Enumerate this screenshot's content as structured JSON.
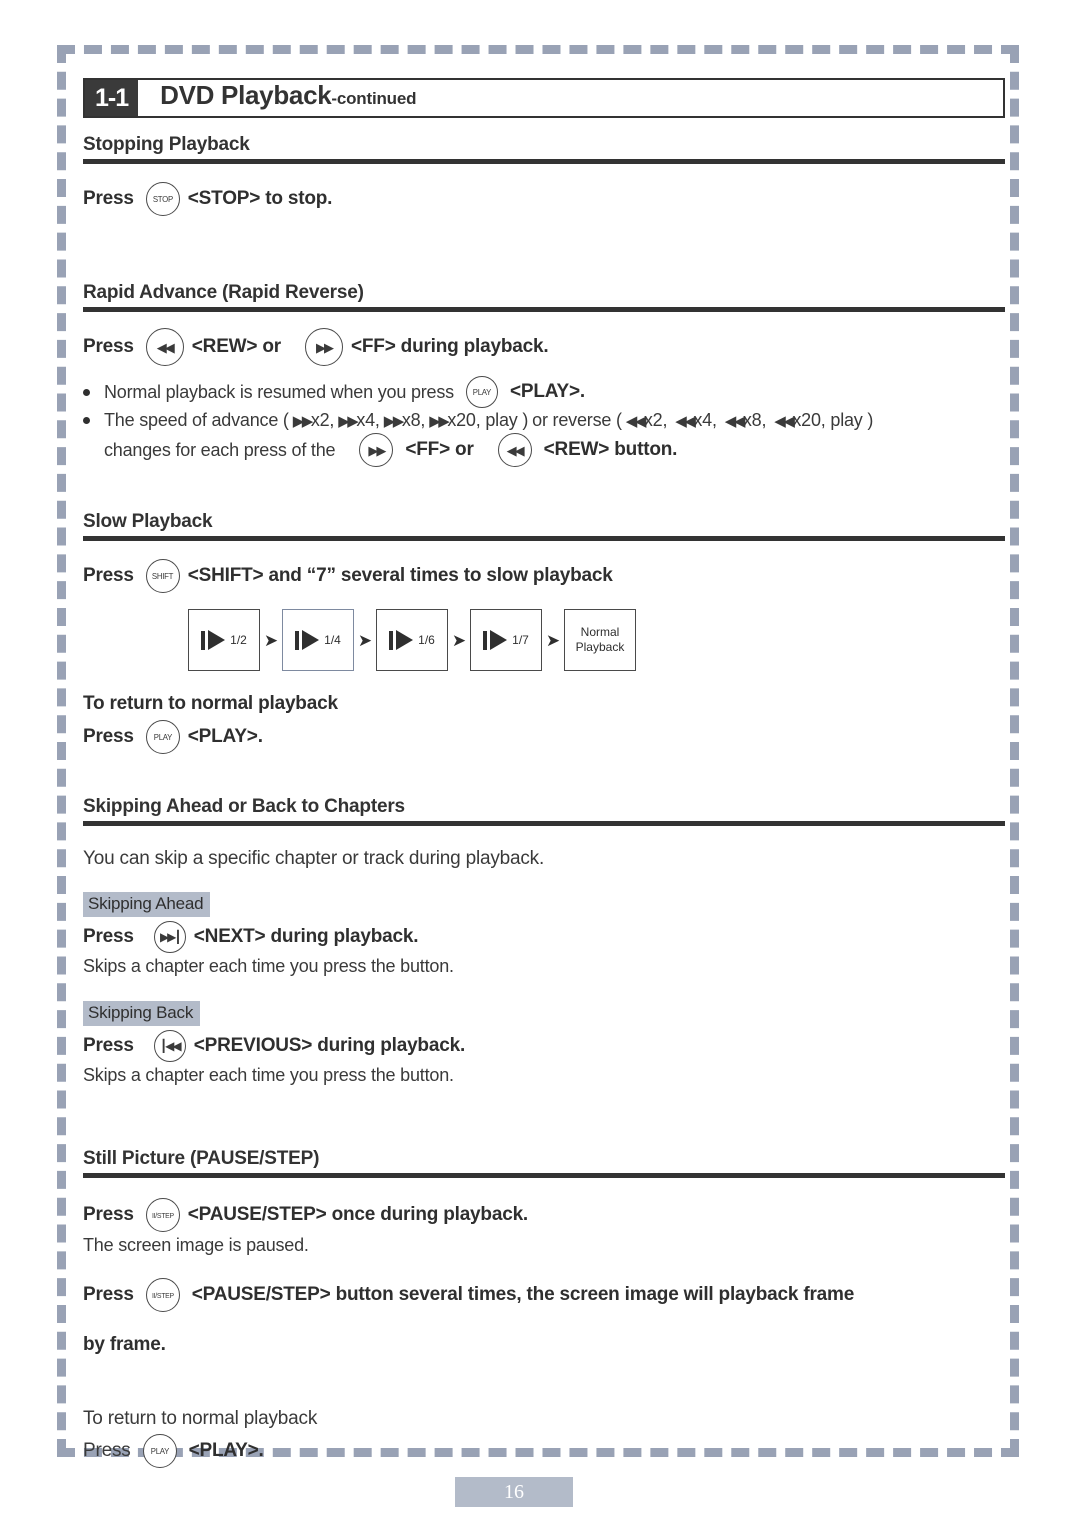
{
  "header": {
    "badge": "1-1",
    "title_main": "DVD Playback",
    "title_suffix": "-continued"
  },
  "sections": {
    "stopping": {
      "heading": "Stopping Playback",
      "press_label": "Press",
      "button": "STOP",
      "text": "<STOP> to stop."
    },
    "rapid": {
      "heading": "Rapid Advance (Rapid Reverse)",
      "press_label": "Press",
      "btn_rew": "rew-glyph",
      "text_rew": "<REW> or",
      "btn_ff": "ff-glyph",
      "text_ff": "<FF> during playback.",
      "bullet1_pre": "Normal playback is resumed when you press",
      "bullet1_btn": "PLAY",
      "bullet1_post": "<PLAY>.",
      "bullet2_a": "The speed of advance (",
      "bullet2_fwd": [
        "x2,",
        "x4,",
        "x8,",
        "x20, play )"
      ],
      "bullet2_b": "or reverse (",
      "bullet2_rev": [
        "x2,",
        "x4,",
        "x8,",
        "x20, play )"
      ],
      "bullet2_c": "changes for each press of the",
      "bullet2_ff": "<FF> or",
      "bullet2_rew": "<REW> button."
    },
    "slow": {
      "heading": "Slow Playback",
      "press_label": "Press",
      "button": "SHIFT",
      "text": "<SHIFT> and “7” several times to slow playback",
      "steps": [
        "1/2",
        "1/4",
        "1/6",
        "1/7"
      ],
      "final_step_line1": "Normal",
      "final_step_line2": "Playback",
      "arrow": "➤",
      "return_title": "To return to normal playback",
      "return_press": "Press",
      "return_button": "PLAY",
      "return_text": "<PLAY>."
    },
    "skipping": {
      "heading": "Skipping Ahead or Back to Chapters",
      "intro": "You can skip a specific chapter or track during playback.",
      "ahead": {
        "label": "Skipping Ahead",
        "press_label": "Press",
        "button": "next-glyph",
        "text": "<NEXT> during playback.",
        "note": "Skips a chapter each time you press the button."
      },
      "back": {
        "label": "Skipping Back",
        "press_label": "Press",
        "button": "previous-glyph",
        "text": "<PREVIOUS> during playback.",
        "note": "Skips a chapter each time you press the button."
      }
    },
    "still": {
      "heading": "Still Picture (PAUSE/STEP)",
      "press1_label": "Press",
      "button1": "II/STEP",
      "text1": "<PAUSE/STEP> once during playback.",
      "note1": "The screen image is paused.",
      "press2_label": "Press",
      "button2": "II/STEP",
      "text2": "<PAUSE/STEP> button several times, the screen image will playback frame",
      "text2_cont": "by frame.",
      "return_title": "To return to normal playback",
      "return_press": "Press",
      "return_button": "PLAY",
      "return_text": "<PLAY>."
    }
  },
  "footer": {
    "page_number": "16"
  },
  "colors": {
    "frame_dash": "#99a2b5",
    "badge_bg": "#3a3a3a",
    "highlight_bg": "#b3bbc9",
    "rule": "#333333",
    "text": "#2f2f2f"
  }
}
